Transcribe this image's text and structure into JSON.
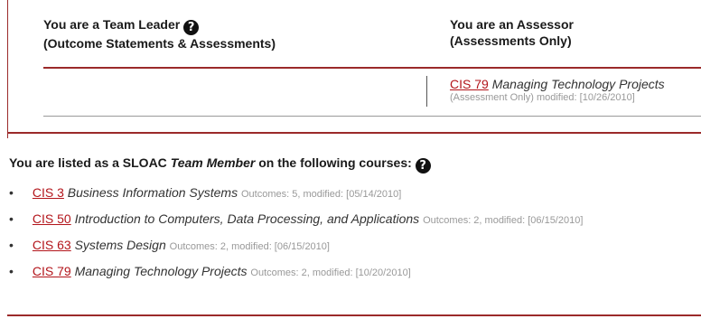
{
  "roles": {
    "leader_heading_line1": "You are a Team Leader",
    "leader_heading_line2": "(Outcome Statements & Assessments)",
    "assessor_heading_line1": "You are an Assessor",
    "assessor_heading_line2": "(Assessments Only)",
    "help_symbol": "?",
    "assessor_courses": [
      {
        "code": "CIS 79",
        "title": "Managing Technology Projects",
        "meta": "(Assessment Only) modified: [10/26/2010]"
      }
    ]
  },
  "member": {
    "heading_prefix": "You are listed as a SLOAC",
    "heading_role": "Team Member",
    "heading_suffix": "on the following courses:",
    "help_symbol": "?",
    "bullet": "•",
    "courses": [
      {
        "code": "CIS 3",
        "title": "Business Information Systems",
        "meta": "Outcomes: 5, modified: [05/14/2010]"
      },
      {
        "code": "CIS 50",
        "title": "Introduction to Computers, Data Processing, and Applications",
        "meta": "Outcomes: 2, modified: [06/15/2010]"
      },
      {
        "code": "CIS 63",
        "title": "Systems Design",
        "meta": "Outcomes: 2, modified: [06/15/2010]"
      },
      {
        "code": "CIS 79",
        "title": "Managing Technology Projects",
        "meta": "Outcomes: 2, modified: [10/20/2010]"
      }
    ]
  },
  "colors": {
    "accent": "#9b2a2a",
    "link": "#b3151b",
    "meta": "#999999"
  }
}
